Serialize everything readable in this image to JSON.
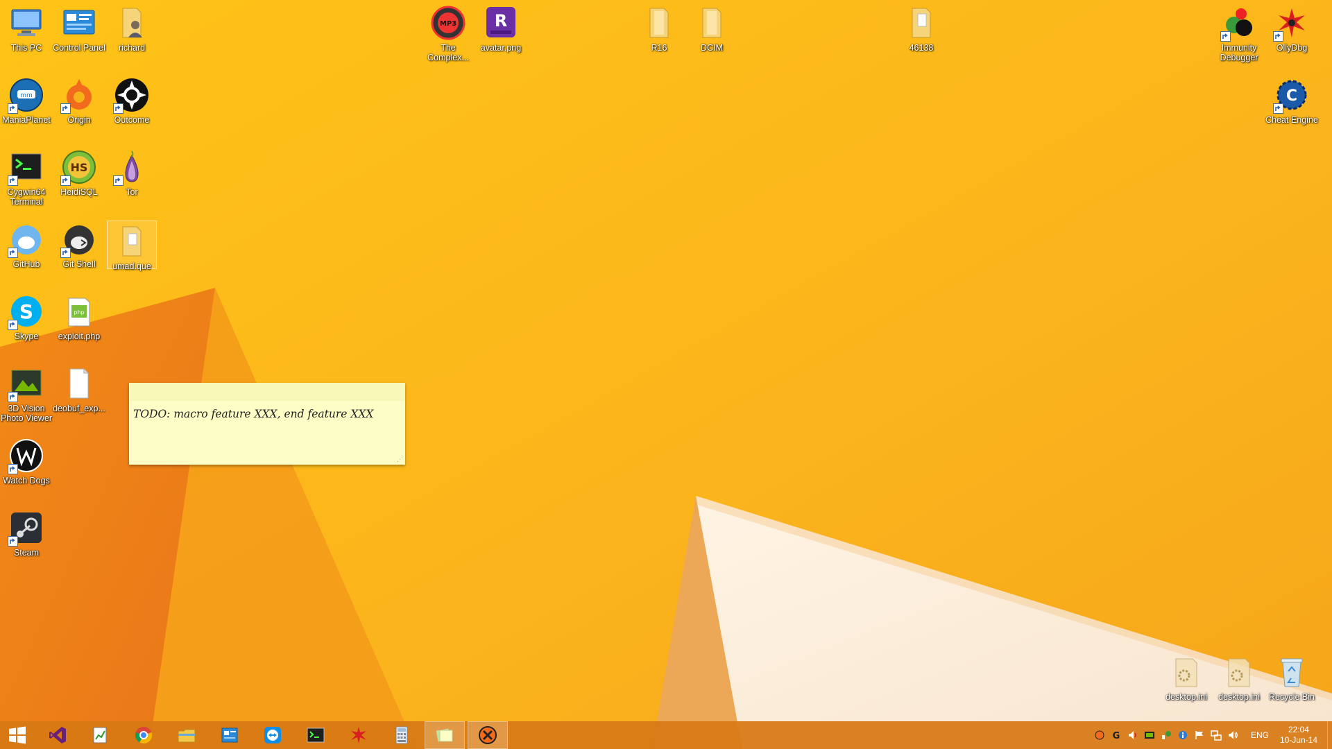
{
  "desktop": {
    "icons_left": [
      {
        "label": "This PC",
        "icon": "computer-icon"
      },
      {
        "label": "Control Panel",
        "icon": "control-panel-icon"
      },
      {
        "label": "richard",
        "icon": "user-folder-icon"
      },
      {
        "label": "ManiaPlanet",
        "icon": "maniaplanet-icon"
      },
      {
        "label": "Origin",
        "icon": "origin-icon"
      },
      {
        "label": "Outcome",
        "icon": "outcome-icon"
      },
      {
        "label": "Cygwin64 Terminal",
        "icon": "terminal-icon"
      },
      {
        "label": "HeidiSQL",
        "icon": "heidisql-icon"
      },
      {
        "label": "Tor",
        "icon": "tor-onion-icon"
      },
      {
        "label": "GitHub",
        "icon": "github-icon"
      },
      {
        "label": "Git Shell",
        "icon": "git-shell-icon"
      },
      {
        "label": "umad.que",
        "icon": "folder-icon"
      },
      {
        "label": "Skype",
        "icon": "skype-icon"
      },
      {
        "label": "exploit.php",
        "icon": "php-file-icon"
      },
      {
        "label": "3D Vision Photo Viewer",
        "icon": "3d-vision-icon"
      },
      {
        "label": "deobuf_exp...",
        "icon": "text-file-icon"
      },
      {
        "label": "Watch Dogs",
        "icon": "watch-dogs-icon"
      },
      {
        "label": "Steam",
        "icon": "steam-icon"
      }
    ],
    "icons_top": [
      {
        "label": "The Complex...",
        "icon": "mp3-icon"
      },
      {
        "label": "avatar.png",
        "icon": "image-file-icon"
      },
      {
        "label": "R16",
        "icon": "folder-icon"
      },
      {
        "label": "DCIM",
        "icon": "folder-icon"
      },
      {
        "label": "46138",
        "icon": "folder-icon"
      }
    ],
    "icons_right": [
      {
        "label": "Immunity Debugger",
        "icon": "immunity-debugger-icon"
      },
      {
        "label": "OllyDbg",
        "icon": "ollydbg-icon"
      },
      {
        "label": "Cheat Engine",
        "icon": "cheat-engine-icon"
      },
      {
        "label": "desktop.ini",
        "icon": "ini-file-icon"
      },
      {
        "label": "desktop.ini",
        "icon": "ini-file-icon"
      },
      {
        "label": "Recycle Bin",
        "icon": "recycle-bin-icon"
      }
    ]
  },
  "sticky_note": {
    "text": "TODO: macro feature XXX, end feature XXX"
  },
  "taskbar": {
    "apps": [
      {
        "name": "start-button"
      },
      {
        "name": "visual-studio-icon"
      },
      {
        "name": "chart-app-icon"
      },
      {
        "name": "chrome-icon"
      },
      {
        "name": "file-explorer-icon"
      },
      {
        "name": "control-panel-icon"
      },
      {
        "name": "teamviewer-icon"
      },
      {
        "name": "terminal-icon"
      },
      {
        "name": "ollydbg-icon"
      },
      {
        "name": "calculator-icon"
      },
      {
        "name": "sticky-notes-icon"
      },
      {
        "name": "origin-game-icon"
      }
    ],
    "language": "ENG",
    "time": "22:04",
    "date": "10-Jun-14"
  },
  "colors": {
    "wallpaper_light": "#FFC21C",
    "wallpaper_dark": "#EE7A12",
    "taskbar": "#D77814",
    "sticky": "#FDFDC6"
  }
}
